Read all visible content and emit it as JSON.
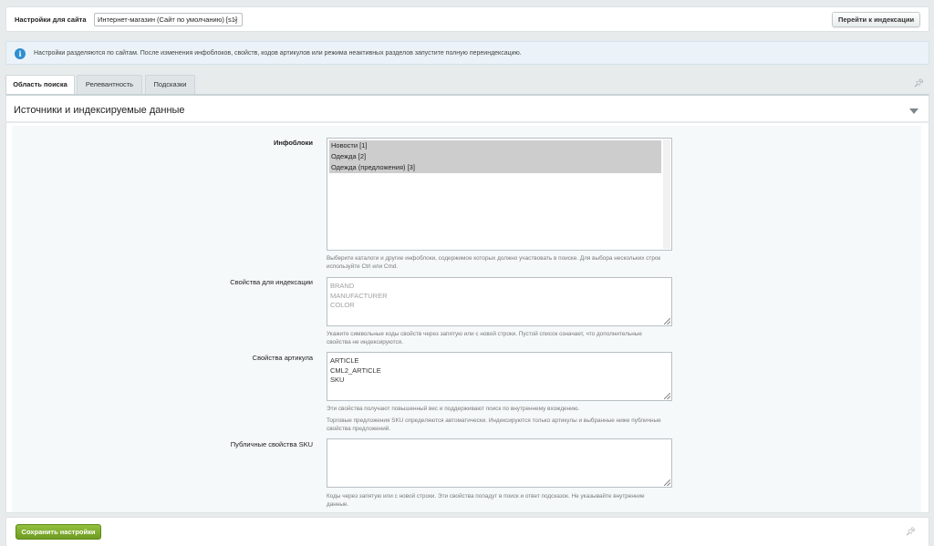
{
  "topbar": {
    "site_label": "Настройки для сайта",
    "site_select_value": "Интернет-магазин (Сайт по умолчанию) [s1]",
    "reindex_button": "Перейти к индексации"
  },
  "notice": {
    "icon": "info-icon",
    "text": "Настройки разделяются по сайтам. После изменения инфоблоков, свойств, кодов артикулов или режима неактивных разделов запустите полную переиндексацию."
  },
  "tabs": [
    {
      "label": "Область поиска",
      "active": true
    },
    {
      "label": "Релевантность",
      "active": false
    },
    {
      "label": "Подсказки",
      "active": false
    }
  ],
  "section": {
    "title": "Источники и индексируемые данные"
  },
  "fields": {
    "iblocks": {
      "label": "Инфоблоки",
      "options": [
        "Новости [1]",
        "Одежда [2]",
        "Одежда (предложения) [3]"
      ],
      "hint": "Выберите каталоги и другие инфоблоки, содержимое которых должно участвовать в поиске. Для выбора нескольких строк используйте Ctrl или Cmd."
    },
    "index_props": {
      "label": "Свойства для индексации",
      "placeholder_lines": [
        "BRAND",
        "MANUFACTURER",
        "COLOR"
      ],
      "hint": "Укажите символьные коды свойств через запятую или с новой строки. Пустой список означает, что дополнительные свойства не индексируются."
    },
    "article_props": {
      "label": "Свойства артикула",
      "lines": [
        "ARTICLE",
        "CML2_ARTICLE",
        "SKU"
      ],
      "hint1": "Эти свойства получают повышенный вес и поддерживают поиск по внутреннему вхождению.",
      "hint2": "Торговые предложения SKU определяются автоматически. Индексируются только артикулы и выбранные ниже публичные свойства предложений."
    },
    "sku_props": {
      "label": "Публичные свойства SKU",
      "hint": "Коды через запятую или с новой строки. Эти свойства попадут в поиск и ответ подсказок. Не указывайте внутренние данные."
    }
  },
  "footer": {
    "save_button": "Сохранить настройки"
  }
}
